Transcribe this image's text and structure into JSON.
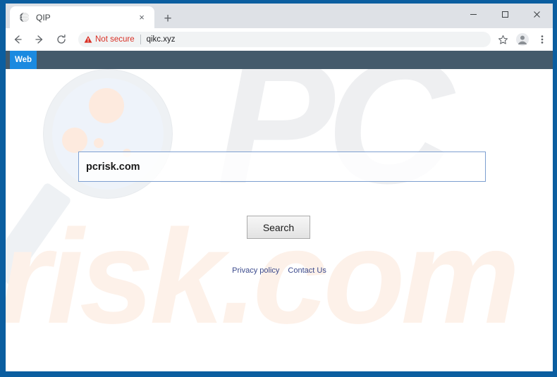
{
  "browser": {
    "tab": {
      "title": "QIP",
      "favicon_icon": "globe-icon",
      "close_icon": "×"
    },
    "new_tab_icon": "+",
    "window_controls": {
      "minimize_icon": "–",
      "maximize_icon": "□",
      "close_icon": "✕"
    },
    "toolbar": {
      "back_icon": "←",
      "forward_icon": "→",
      "reload_icon": "↻",
      "security_warning_icon": "⚠",
      "security_label": "Not secure",
      "url": "qikc.xyz",
      "bookmark_icon": "☆",
      "profile_icon": "profile-avatar-icon",
      "menu_icon": "⋮"
    }
  },
  "page": {
    "navbar": {
      "web_tab_label": "Web"
    },
    "search": {
      "value": "pcrisk.com",
      "placeholder": "",
      "submit_label": "Search"
    },
    "footer": {
      "links": [
        {
          "label": "Privacy policy"
        },
        {
          "label": "Contact Us"
        }
      ]
    },
    "watermark": {
      "logo_top": "PC",
      "logo_bottom": "risk.com"
    }
  },
  "colors": {
    "window_frame": "#0b5ea0",
    "site_navbar": "#445a6b",
    "web_tab": "#1b8ae0",
    "not_secure": "#d93025",
    "search_border": "#7d9fd0",
    "footer_link": "#3b4a8c",
    "watermark_gray": "#eeeff1",
    "watermark_peach": "#fdf1e9"
  }
}
